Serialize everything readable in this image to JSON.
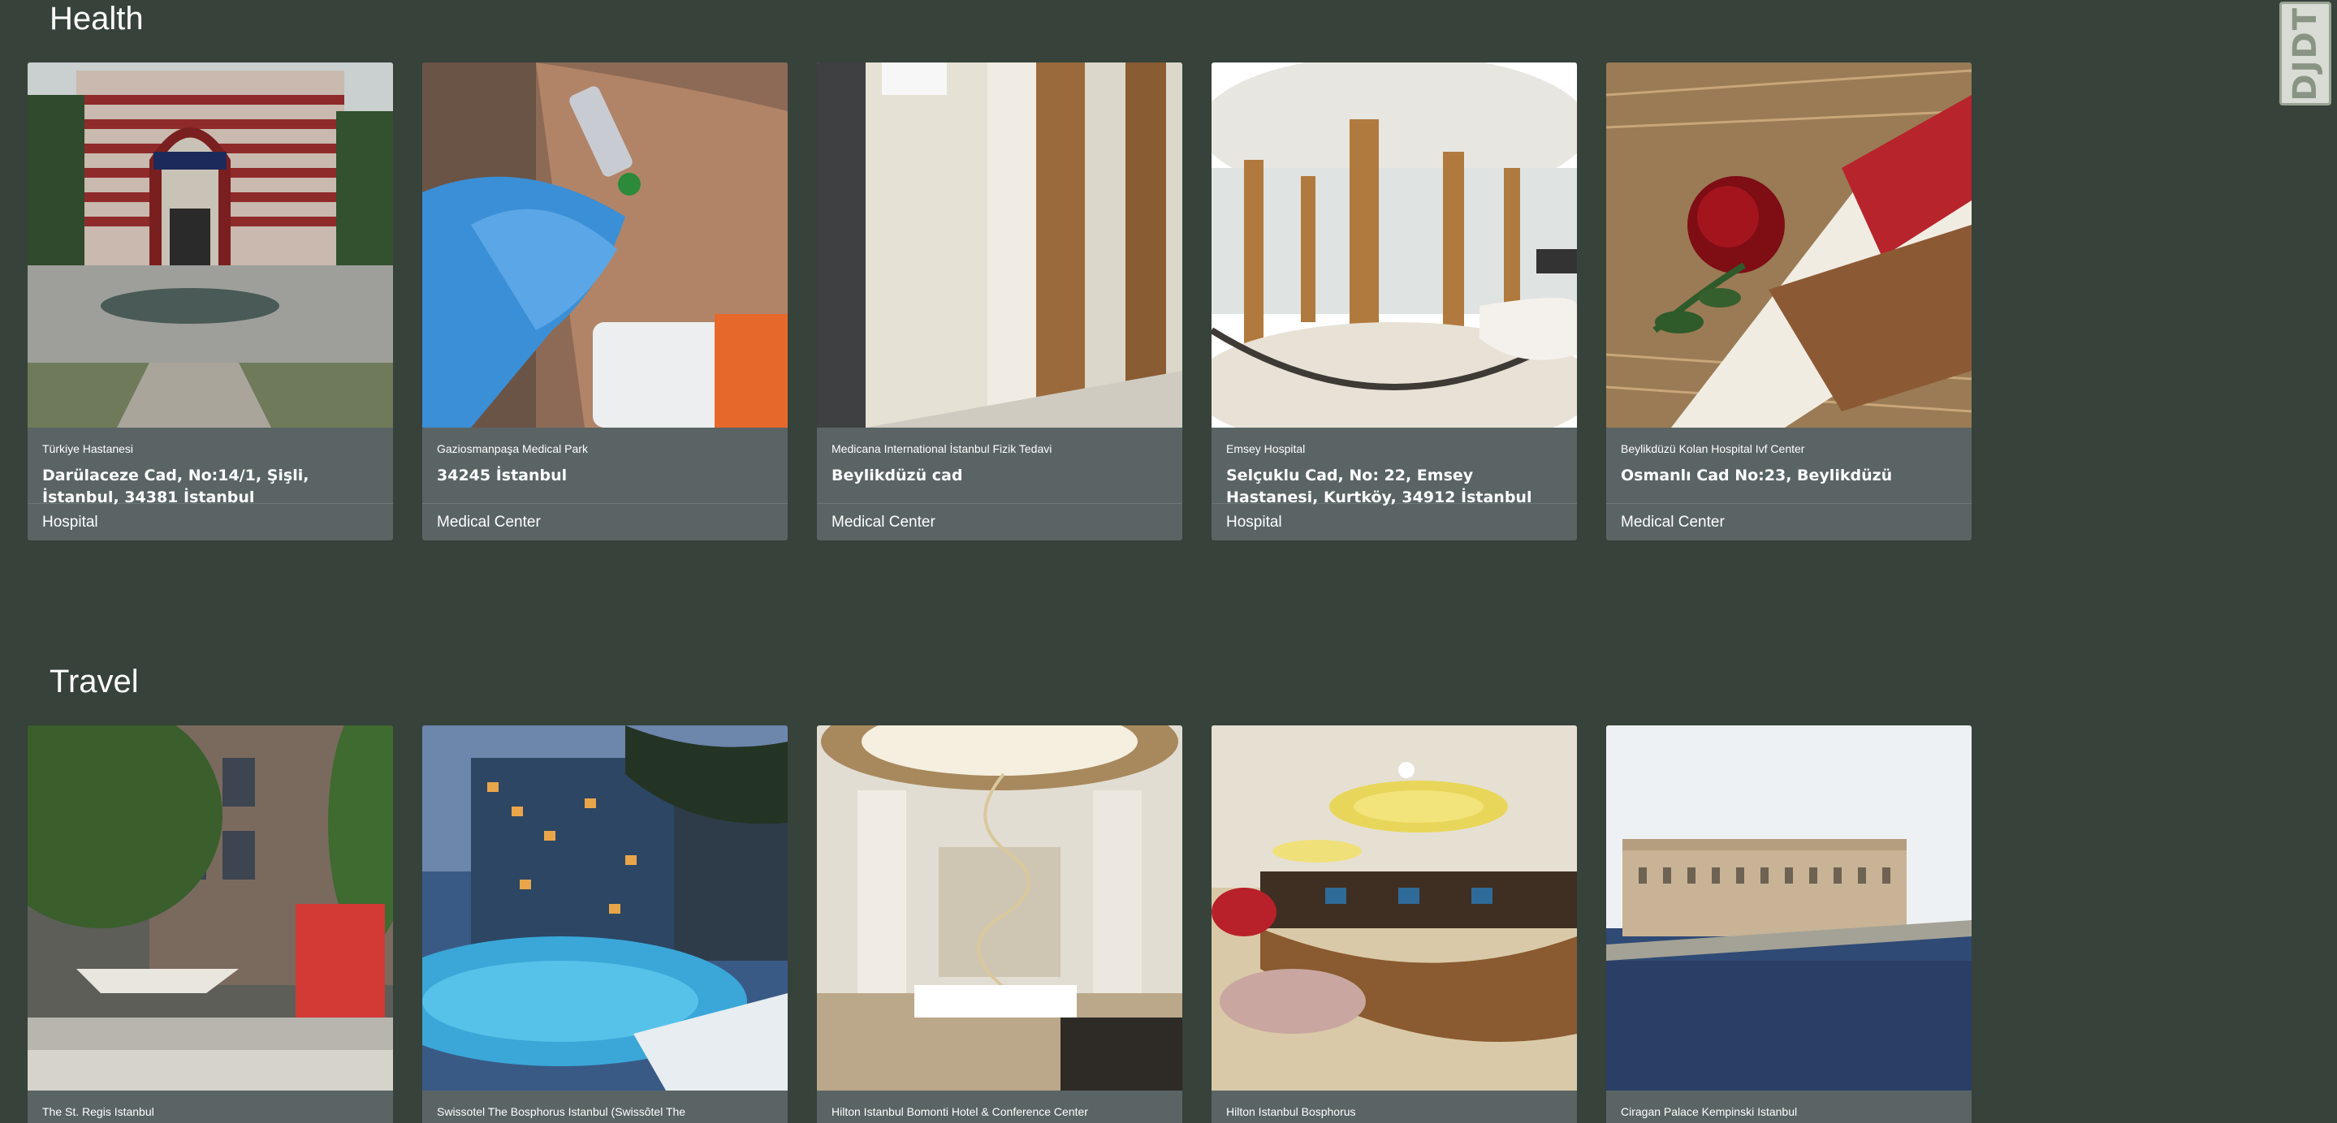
{
  "logo": {
    "text": "DJDT"
  },
  "sections": [
    {
      "title": "Health",
      "cards": [
        {
          "name": "Türkiye Hastanesi",
          "address": "Darülaceze Cad, No:14/1, Şişli, İstanbul, 34381 İstanbul",
          "category": "Hospital"
        },
        {
          "name": "Gaziosmanpaşa Medical Park",
          "address": "34245 İstanbul",
          "category": "Medical Center"
        },
        {
          "name": "Medicana International İstanbul Fizik Tedavi",
          "address": "Beylikdüzü cad",
          "category": "Medical Center"
        },
        {
          "name": "Emsey Hospital",
          "address": "Selçuklu Cad, No: 22, Emsey Hastanesi, Kurtköy, 34912 İstanbul",
          "category": "Hospital"
        },
        {
          "name": "Beylikdüzü Kolan Hospital Ivf Center",
          "address": "Osmanlı Cad No:23, Beylikdüzü",
          "category": "Medical Center"
        }
      ]
    },
    {
      "title": "Travel",
      "cards": [
        {
          "name": "The St. Regis Istanbul",
          "address": "",
          "category": ""
        },
        {
          "name": "Swissotel The Bosphorus Istanbul (Swissôtel The",
          "address": "",
          "category": ""
        },
        {
          "name": "Hilton Istanbul Bomonti Hotel & Conference Center",
          "address": "",
          "category": ""
        },
        {
          "name": "Hilton Istanbul Bosphorus",
          "address": "",
          "category": ""
        },
        {
          "name": "Ciragan Palace Kempinski Istanbul",
          "address": "",
          "category": ""
        }
      ]
    }
  ]
}
